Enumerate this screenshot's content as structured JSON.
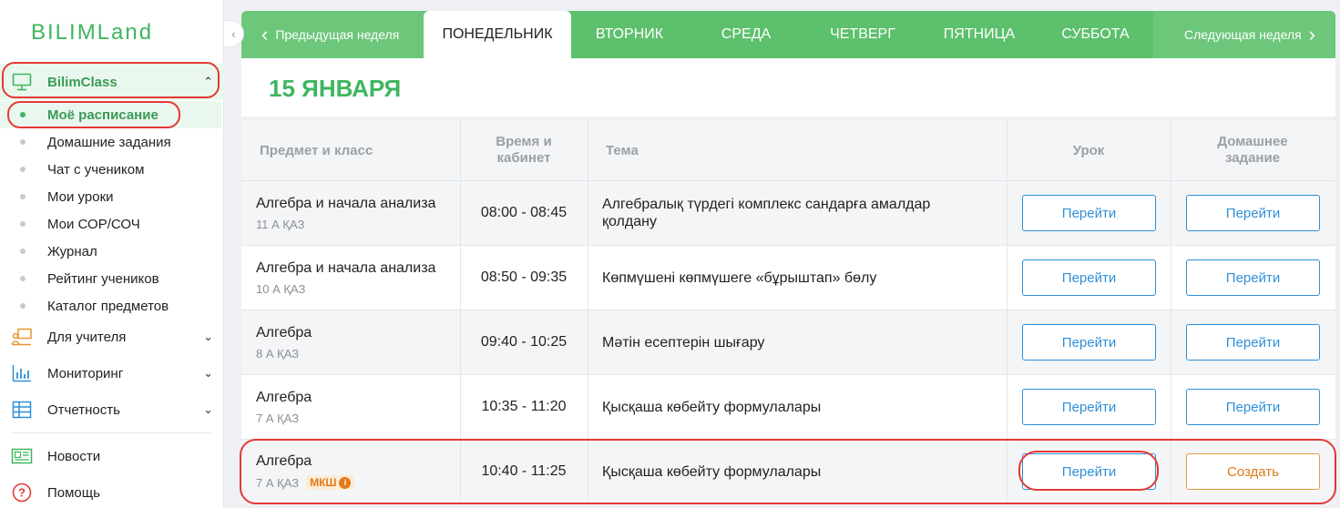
{
  "sidebar": {
    "logo": "BILIMLand",
    "collapse_icon": "chevron-left-icon",
    "groups": [
      {
        "label": "BilimClass",
        "icon": "monitor-icon"
      },
      {
        "label": "Для учителя",
        "icon": "teacher-board-icon"
      },
      {
        "label": "Мониторинг",
        "icon": "bar-chart-icon"
      },
      {
        "label": "Отчетность",
        "icon": "table-icon"
      },
      {
        "label": "Новости",
        "icon": "newspaper-icon"
      },
      {
        "label": "Помощь",
        "icon": "help-icon"
      }
    ],
    "sub_items": [
      "Моё расписание",
      "Домашние задания",
      "Чат с учеником",
      "Мои уроки",
      "Мои СОР/СОЧ",
      "Журнал",
      "Рейтинг учеников",
      "Каталог предметов"
    ]
  },
  "week": {
    "prev": "Предыдущая неделя",
    "next": "Следующая неделя",
    "days": [
      "ПОНЕДЕЛЬНИК",
      "ВТОРНИК",
      "СРЕДА",
      "ЧЕТВЕРГ",
      "ПЯТНИЦА",
      "СУББОТА"
    ],
    "active_day": "ПОНЕДЕЛЬНИК"
  },
  "date_title": "15 ЯНВАРЯ",
  "table": {
    "headers": {
      "subject": "Предмет и класс",
      "time": "Время и кабинет",
      "topic": "Тема",
      "lesson": "Урок",
      "homework": "Домашнее задание"
    },
    "rows": [
      {
        "subject": "Алгебра и начала анализа",
        "class": "11 А ҚАЗ",
        "badge": "",
        "time": "08:00 - 08:45",
        "topic": "Алгебралық түрдегі комплекс сандарға амалдар қолдану",
        "lesson_btn": "Перейти",
        "hw_btn": "Перейти"
      },
      {
        "subject": "Алгебра и начала анализа",
        "class": "10 А ҚАЗ",
        "badge": "",
        "time": "08:50 - 09:35",
        "topic": "Көпмүшені көпмүшеге «бұрыштап» бөлу",
        "lesson_btn": "Перейти",
        "hw_btn": "Перейти"
      },
      {
        "subject": "Алгебра",
        "class": "8 А ҚАЗ",
        "badge": "",
        "time": "09:40 - 10:25",
        "topic": "Мәтін есептерін шығару",
        "lesson_btn": "Перейти",
        "hw_btn": "Перейти"
      },
      {
        "subject": "Алгебра",
        "class": "7 А ҚАЗ",
        "badge": "",
        "time": "10:35 - 11:20",
        "topic": "Қысқаша көбейту формулалары",
        "lesson_btn": "Перейти",
        "hw_btn": "Перейти"
      },
      {
        "subject": "Алгебра",
        "class": "7 А ҚАЗ",
        "badge": "МКШ",
        "time": "10:40 - 11:25",
        "topic": "Қысқаша көбейту формулалары",
        "lesson_btn": "Перейти",
        "hw_btn": "Создать"
      }
    ]
  },
  "colors": {
    "brand_green": "#3fb55f",
    "link_blue": "#2f8fd8",
    "accent_orange": "#e07b1a",
    "highlight_red": "#e53935"
  }
}
